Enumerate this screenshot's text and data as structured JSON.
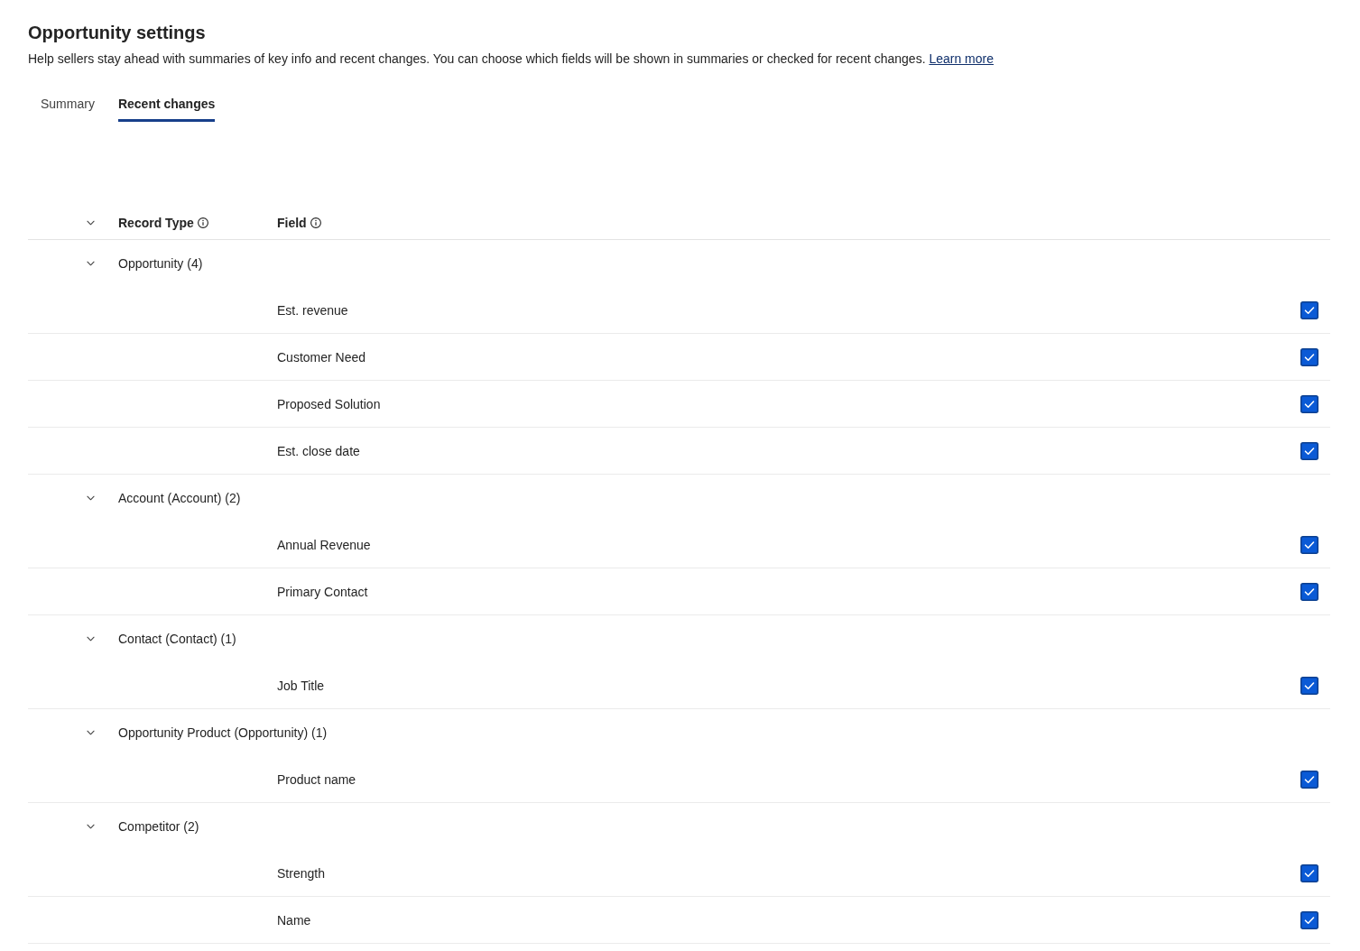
{
  "page": {
    "title": "Opportunity settings",
    "description": "Help sellers stay ahead with summaries of key info and recent changes. You can choose which fields will be shown in summaries or checked for recent changes.",
    "learn_more_link": "Learn more"
  },
  "tabs": [
    {
      "label": "Summary",
      "selected": false
    },
    {
      "label": "Recent changes",
      "selected": true
    }
  ],
  "table": {
    "expand_all": {
      "expanded": true
    },
    "columns": [
      {
        "label": "Record Type",
        "info": true
      },
      {
        "label": "Field",
        "info": true
      }
    ],
    "groups": [
      {
        "label": "Opportunity (4)",
        "expanded": true,
        "children": [
          {
            "label": "Est. revenue",
            "checked": true
          },
          {
            "label": "Customer Need",
            "checked": true
          },
          {
            "label": "Proposed Solution",
            "checked": true
          },
          {
            "label": "Est. close date",
            "checked": true
          }
        ]
      },
      {
        "label": "Account (Account) (2)",
        "expanded": true,
        "children": [
          {
            "label": "Annual Revenue",
            "checked": true
          },
          {
            "label": "Primary Contact",
            "checked": true
          }
        ]
      },
      {
        "label": "Contact (Contact) (1)",
        "expanded": true,
        "children": [
          {
            "label": "Job Title",
            "checked": true
          }
        ]
      },
      {
        "label": "Opportunity Product (Opportunity) (1)",
        "expanded": true,
        "children": [
          {
            "label": "Product name",
            "checked": true
          }
        ]
      },
      {
        "label": "Competitor (2)",
        "expanded": true,
        "children": [
          {
            "label": "Strength",
            "checked": true
          },
          {
            "label": "Name",
            "checked": true
          }
        ]
      }
    ]
  }
}
